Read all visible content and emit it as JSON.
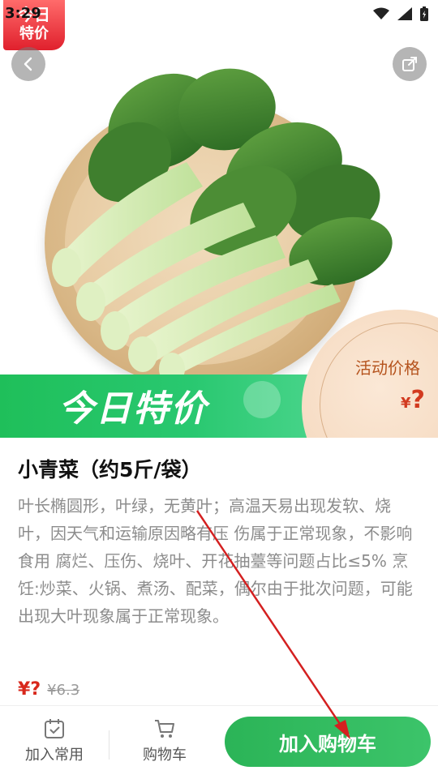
{
  "status_bar": {
    "time": "3:29"
  },
  "corner_tag": {
    "line1": "今日",
    "line2": "特价"
  },
  "banner": {
    "text": "今日特价"
  },
  "promo": {
    "label": "活动价格",
    "currency": "¥",
    "price": "?"
  },
  "product": {
    "title": "小青菜（约5斤/袋）",
    "description": "叶长椭圆形，叶绿，无黄叶；高温天易出现发软、烧叶，因天气和运输原因略有压 伤属于正常现象，不影响食用 腐烂、压伤、烧叶、开花抽薹等问题占比≤5% 烹饪:炒菜、火锅、煮汤、配菜，偶尔由于批次问题，可能出现大叶现象属于正常现象。",
    "price_currency": "¥",
    "price_value": "?",
    "original_price": "¥6.3"
  },
  "bottom_bar": {
    "favorite_label": "加入常用",
    "cart_label": "购物车",
    "add_button_label": "加入购物车"
  },
  "colors": {
    "accent_green": "#2bb457",
    "price_red": "#d8281c"
  }
}
